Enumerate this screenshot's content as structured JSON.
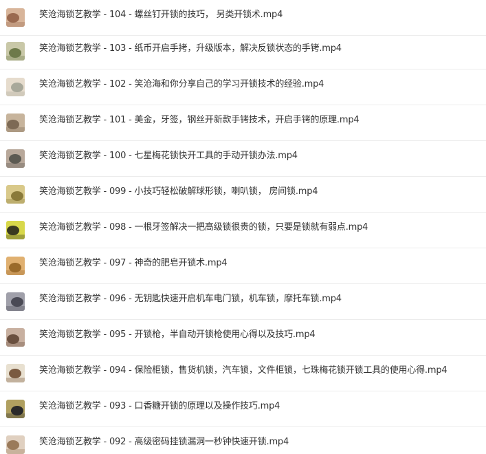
{
  "files": [
    {
      "name": "笑沧海锁艺教学 - 104 - 螺丝钉开锁的技巧，  另类开锁术.mp4",
      "thumb_icon": "video-thumbnail-icon",
      "thumb_colors": [
        "#9a6a50",
        "#d8b59a"
      ]
    },
    {
      "name": "笑沧海锁艺教学 - 103 - 纸币开启手拷，升级版本，解决反锁状态的手铐.mp4",
      "thumb_icon": "video-thumbnail-icon",
      "thumb_colors": [
        "#6e7a4a",
        "#c9c8a8"
      ]
    },
    {
      "name": "笑沧海锁艺教学 - 102 - 笑沧海和你分享自己的学习开锁技术的经验.mp4",
      "thumb_icon": "video-thumbnail-icon",
      "thumb_colors": [
        "#a8a89a",
        "#e6dccd"
      ]
    },
    {
      "name": "笑沧海锁艺教学 - 101 - 美金，牙签，钢丝开新款手铐技术，开启手铐的原理.mp4",
      "thumb_icon": "video-thumbnail-icon",
      "thumb_colors": [
        "#7d6a55",
        "#c7b49c"
      ]
    },
    {
      "name": "笑沧海锁艺教学 - 100 - 七星梅花锁快开工具的手动开锁办法.mp4",
      "thumb_icon": "video-thumbnail-icon",
      "thumb_colors": [
        "#5c5a52",
        "#b8a89a"
      ]
    },
    {
      "name": "笑沧海锁艺教学 - 099 - 小技巧轻松破解球形锁，喇叭锁，  房间锁.mp4",
      "thumb_icon": "video-thumbnail-icon",
      "thumb_colors": [
        "#8a7a3a",
        "#d9c98a"
      ]
    },
    {
      "name": "笑沧海锁艺教学 - 098 - 一根牙签解决一把高级锁很贵的锁，只要是锁就有弱点.mp4",
      "thumb_icon": "video-thumbnail-icon",
      "thumb_colors": [
        "#3a3a20",
        "#d8d84a"
      ]
    },
    {
      "name": "笑沧海锁艺教学 - 097 - 神奇的肥皂开锁术.mp4",
      "thumb_icon": "video-thumbnail-icon",
      "thumb_colors": [
        "#9a6a2a",
        "#e0b070"
      ]
    },
    {
      "name": "笑沧海锁艺教学 - 096 - 无钥匙快速开启机车电门锁，机车锁，摩托车锁.mp4",
      "thumb_icon": "video-thumbnail-icon",
      "thumb_colors": [
        "#4a4a55",
        "#a0a0aa"
      ]
    },
    {
      "name": "笑沧海锁艺教学 - 095 - 开锁枪，半自动开锁枪使用心得以及技巧.mp4",
      "thumb_icon": "video-thumbnail-icon",
      "thumb_colors": [
        "#6a5040",
        "#c8b0a0"
      ]
    },
    {
      "name": "笑沧海锁艺教学 - 094 - 保险柜锁，售货机锁，汽车锁，文件柜锁，七珠梅花锁开锁工具的使用心得.mp4",
      "thumb_icon": "video-thumbnail-icon",
      "thumb_colors": [
        "#7a5a40",
        "#e8e0d0"
      ]
    },
    {
      "name": "笑沧海锁艺教学 - 093 - 口香糖开锁的原理以及操作技巧.mp4",
      "thumb_icon": "video-thumbnail-icon",
      "thumb_colors": [
        "#2a2a2a",
        "#b0a060"
      ]
    },
    {
      "name": "笑沧海锁艺教学 - 092 - 高级密码挂锁漏洞一秒钟快速开锁.mp4",
      "thumb_icon": "video-thumbnail-icon",
      "thumb_colors": [
        "#9a7a5a",
        "#e0d0c0"
      ]
    }
  ]
}
